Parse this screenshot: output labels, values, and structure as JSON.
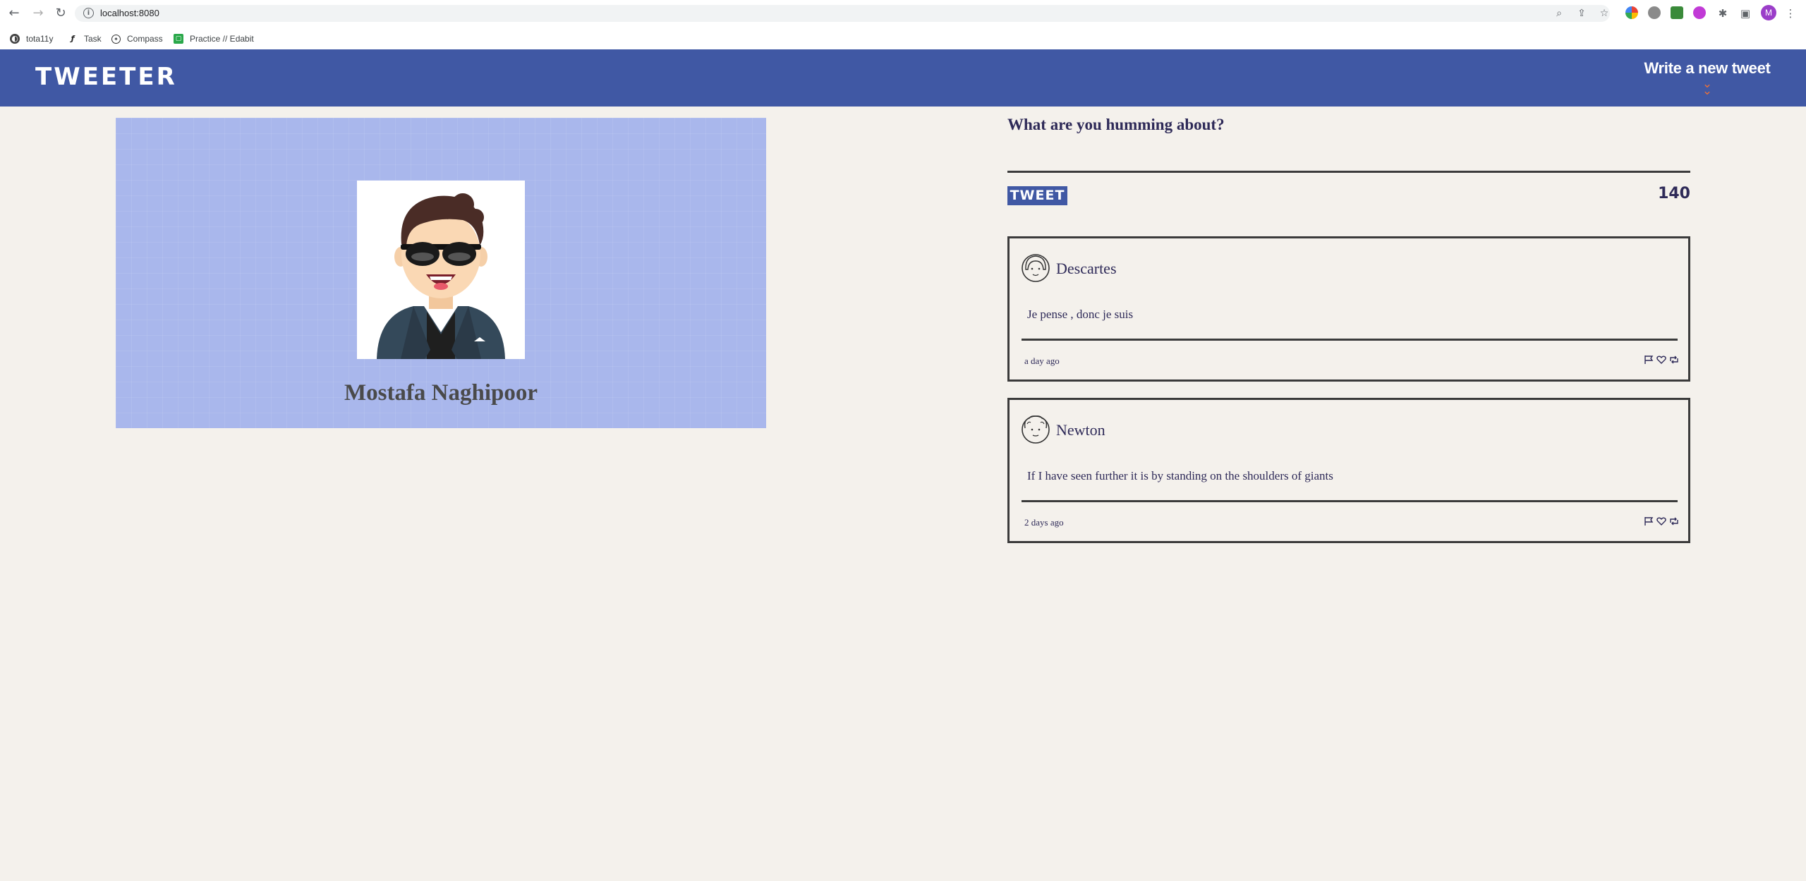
{
  "browser": {
    "url": "localhost:8080",
    "bookmarks": [
      {
        "label": "tota11y",
        "icon": "tota11y-icon"
      },
      {
        "label": "Task",
        "icon": "task-icon"
      },
      {
        "label": "Compass",
        "icon": "compass-icon"
      },
      {
        "label": "Practice // Edabit",
        "icon": "edabit-icon"
      }
    ],
    "profile_initial": "M"
  },
  "header": {
    "logo": "TWEETER",
    "compose_label": "Write a new tweet",
    "compose_icon": "double-chevron-down-icon"
  },
  "profile": {
    "name": "Mostafa Naghipoor"
  },
  "composer": {
    "prompt": "What are you humming about?",
    "submit_label": "TWEET",
    "char_count": "140"
  },
  "tweets": [
    {
      "author": "Descartes",
      "text": "Je pense , donc je suis",
      "time": "a day ago"
    },
    {
      "author": "Newton",
      "text": "If I have seen further it is by standing on the shoulders of giants",
      "time": "2 days ago"
    }
  ],
  "colors": {
    "header_bg": "#4058a4",
    "accent": "#e8703a",
    "page_bg": "#f4f1ec",
    "card_bg": "#a9b7ec",
    "text": "#2e2a58"
  }
}
